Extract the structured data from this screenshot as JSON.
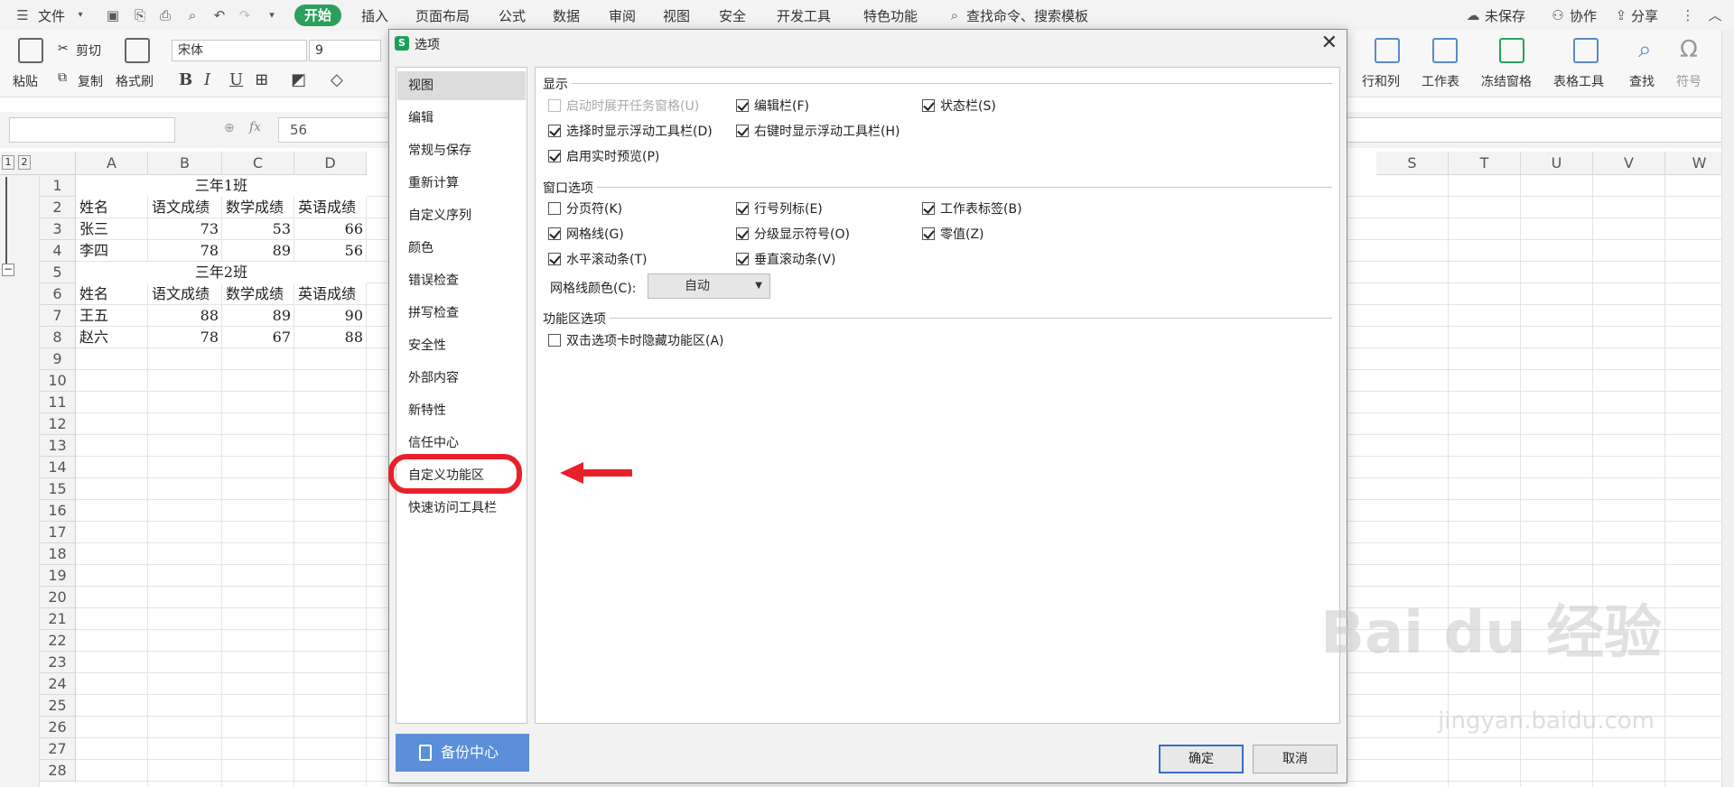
{
  "menubar": {
    "file": "文件",
    "start": "开始",
    "tabs": [
      "插入",
      "页面布局",
      "公式",
      "数据",
      "审阅",
      "视图",
      "安全",
      "开发工具",
      "特色功能"
    ],
    "search": "查找命令、搜索模板",
    "unsaved": "未保存",
    "collab": "协作",
    "share": "分享"
  },
  "ribbon": {
    "paste": "粘贴",
    "cut": "剪切",
    "copy": "复制",
    "format_painter": "格式刷",
    "font_name": "宋体",
    "font_size": "9",
    "right_tools": [
      "行和列",
      "工作表",
      "冻结窗格",
      "表格工具",
      "查找",
      "符号"
    ]
  },
  "formula_bar": {
    "fx": "fx",
    "value": "56"
  },
  "sheet": {
    "group_levels": [
      "1",
      "2"
    ],
    "columns_left": [
      "A",
      "B",
      "C",
      "D"
    ],
    "columns_right": [
      "S",
      "T",
      "U",
      "V",
      "W"
    ],
    "rows": [
      "1",
      "2",
      "3",
      "4",
      "5",
      "6",
      "7",
      "8",
      "9",
      "10",
      "11",
      "12",
      "13",
      "14",
      "15",
      "16",
      "17",
      "18",
      "19",
      "20",
      "21",
      "22",
      "23",
      "24",
      "25",
      "26",
      "27",
      "28"
    ],
    "title1": "三年1班",
    "title2": "三年2班",
    "headers": [
      "姓名",
      "语文成绩",
      "数学成绩",
      "英语成绩"
    ],
    "class1": [
      [
        "张三",
        "73",
        "53",
        "66"
      ],
      [
        "李四",
        "78",
        "89",
        "56"
      ]
    ],
    "class2": [
      [
        "王五",
        "88",
        "89",
        "90"
      ],
      [
        "赵六",
        "78",
        "67",
        "88"
      ]
    ]
  },
  "dialog": {
    "title": "选项",
    "nav": [
      "视图",
      "编辑",
      "常规与保存",
      "重新计算",
      "自定义序列",
      "颜色",
      "错误检查",
      "拼写检查",
      "安全性",
      "外部内容",
      "新特性",
      "信任中心",
      "自定义功能区",
      "快速访问工具栏"
    ],
    "selected_nav": "视图",
    "highlighted_nav": "自定义功能区",
    "section_display": "显示",
    "display_options": [
      {
        "label": "启动时展开任务窗格(U)",
        "checked": false,
        "disabled": true
      },
      {
        "label": "编辑栏(F)",
        "checked": true
      },
      {
        "label": "状态栏(S)",
        "checked": true
      },
      {
        "label": "选择时显示浮动工具栏(D)",
        "checked": true
      },
      {
        "label": "右键时显示浮动工具栏(H)",
        "checked": true
      },
      {
        "label": "启用实时预览(P)",
        "checked": true
      }
    ],
    "section_window": "窗口选项",
    "window_options": [
      {
        "label": "分页符(K)",
        "checked": false
      },
      {
        "label": "行号列标(E)",
        "checked": true
      },
      {
        "label": "工作表标签(B)",
        "checked": true
      },
      {
        "label": "网格线(G)",
        "checked": true
      },
      {
        "label": "分级显示符号(O)",
        "checked": true
      },
      {
        "label": "零值(Z)",
        "checked": true
      },
      {
        "label": "水平滚动条(T)",
        "checked": true
      },
      {
        "label": "垂直滚动条(V)",
        "checked": true
      }
    ],
    "grid_color_label": "网格线颜色(C):",
    "grid_color_value": "自动",
    "section_ribbon": "功能区选项",
    "ribbon_options": [
      {
        "label": "双击选项卡时隐藏功能区(A)",
        "checked": false
      }
    ],
    "backup": "备份中心",
    "ok": "确定",
    "cancel": "取消"
  },
  "watermark": {
    "brand": "Bai du 经验",
    "url": "jingyan.baidu.com"
  },
  "colors": {
    "accent_green": "#2aa05a",
    "backup_blue": "#5b8fd9",
    "annotation_red": "#e8202a"
  }
}
